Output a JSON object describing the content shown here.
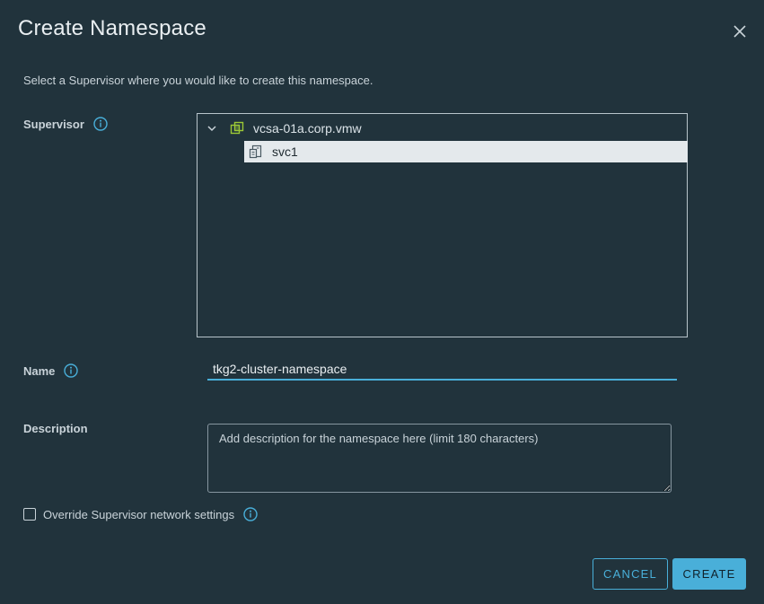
{
  "dialog": {
    "title": "Create Namespace",
    "subtitle": "Select a Supervisor where you would like to create this namespace."
  },
  "icons": {
    "close": "close-icon",
    "info": "info-icon",
    "vcenter": "vcenter-icon",
    "supervisor": "supervisor-icon",
    "chevron": "chevron-down-icon"
  },
  "supervisor": {
    "label": "Supervisor",
    "tree": {
      "root_label": "vcsa-01a.corp.vmw",
      "children": [
        {
          "label": "svc1",
          "selected": true
        }
      ]
    }
  },
  "name": {
    "label": "Name",
    "value": "tkg2-cluster-namespace"
  },
  "description": {
    "label": "Description",
    "placeholder": "Add description for the namespace here (limit 180 characters)"
  },
  "override": {
    "label": "Override Supervisor network settings",
    "checked": false
  },
  "buttons": {
    "cancel": "CANCEL",
    "create": "CREATE"
  },
  "colors": {
    "background": "#21333c",
    "accent": "#49afd9",
    "selected_row": "#e4e9ec",
    "vcenter_icon": "#9cc836"
  }
}
